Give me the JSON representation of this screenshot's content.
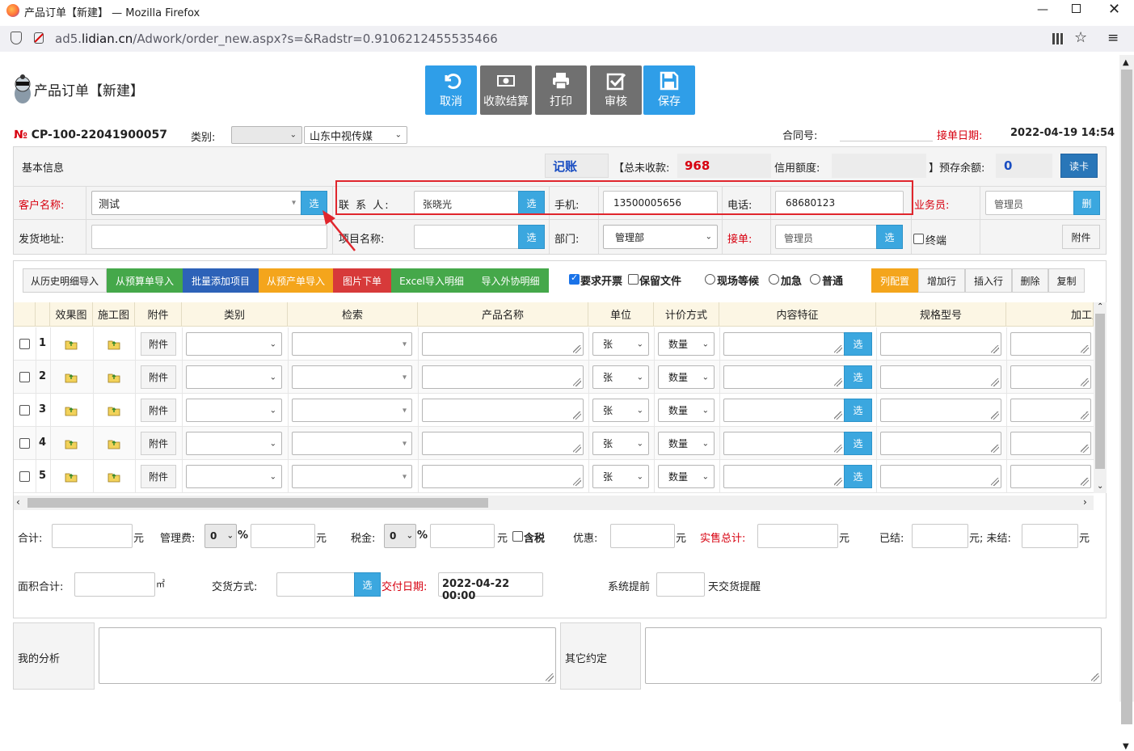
{
  "window": {
    "title": "产品订单【新建】 — Mozilla Firefox"
  },
  "browser": {
    "url_domain": "ad5.",
    "url_domain_bold": "lidian.cn",
    "url_path": "/Adwork/order_new.aspx?s=&Radstr=0.9106212455535466"
  },
  "page": {
    "title": "产品订单【新建】"
  },
  "toolbar": {
    "cancel": "取消",
    "payment": "收款结算",
    "print": "打印",
    "audit": "审核",
    "save": "保存"
  },
  "order": {
    "no_prefix": "№",
    "no": "CP-100-22041900057",
    "category_label": "类别:",
    "category_value": "",
    "company_value": "山东中视传媒",
    "contract_label": "合同号:",
    "receive_date_label": "接单日期:",
    "receive_date": "2022-04-19 14:54"
  },
  "basic": {
    "section_title": "基本信息",
    "bookkeeping": "记账",
    "total_unpaid_label": "【总未收款:",
    "total_unpaid": "968",
    "credit_label": "信用额度:",
    "prepaid_label": "】预存余额:",
    "prepaid": "0",
    "read_card": "读卡",
    "customer_label": "客户名称:",
    "customer_value": "测试",
    "select": "选",
    "contact_label": "联 系 人:",
    "contact_value": "张晓光",
    "mobile_label": "手机:",
    "mobile_value": "13500005656",
    "phone_label": "电话:",
    "phone_value": "68680123",
    "salesman_label": "业务员:",
    "salesman_value": "管理员",
    "delete": "删",
    "address_label": "发货地址:",
    "project_label": "项目名称:",
    "dept_label": "部门:",
    "dept_value": "管理部",
    "taker_label": "接单:",
    "taker_value": "管理员",
    "terminal_label": "终端",
    "attachment": "附件"
  },
  "tools": {
    "history": "从历史明细导入",
    "budget": "从预算单导入",
    "batch": "批量添加项目",
    "preproduce": "从预产单导入",
    "image_order": "图片下单",
    "excel": "Excel导入明细",
    "outsource": "导入外协明细",
    "invoice": "要求开票",
    "keep_file": "保留文件",
    "onsite": "现场等候",
    "urgent": "加急",
    "normal": "普通",
    "col_config": "列配置",
    "add_row": "增加行",
    "insert_row": "插入行",
    "delete": "删除",
    "copy": "复制"
  },
  "table": {
    "headers": [
      "效果图",
      "施工图",
      "附件",
      "类别",
      "检索",
      "产品名称",
      "单位",
      "计价方式",
      "内容特征",
      "规格型号",
      "加工厂"
    ],
    "rows": [
      {
        "no": "1",
        "attach": "附件",
        "unit": "张",
        "pricing": "数量",
        "select": "选"
      },
      {
        "no": "2",
        "attach": "附件",
        "unit": "张",
        "pricing": "数量",
        "select": "选"
      },
      {
        "no": "3",
        "attach": "附件",
        "unit": "张",
        "pricing": "数量",
        "select": "选"
      },
      {
        "no": "4",
        "attach": "附件",
        "unit": "张",
        "pricing": "数量",
        "select": "选"
      },
      {
        "no": "5",
        "attach": "附件",
        "unit": "张",
        "pricing": "数量",
        "select": "选"
      }
    ]
  },
  "totals": {
    "sum_label": "合计:",
    "yuan": "元",
    "mgmt_label": "管理费:",
    "mgmt_pct": "0",
    "pct": "%",
    "tax_label": "税金:",
    "tax_pct": "0",
    "incl_tax": "含税",
    "discount_label": "优惠:",
    "sales_total_label": "实售总计:",
    "settled_label": "已结:",
    "unsettled_label": "元; 未结:",
    "area_label": "面积合计:",
    "sqm": "㎡",
    "delivery_label": "交货方式:",
    "select": "选",
    "delivery_date_label": "交付日期:",
    "delivery_date": "2022-04-22 00:00",
    "advance_label": "系统提前",
    "advance_suffix": "天交货提醒"
  },
  "notes": {
    "analysis_label": "我的分析",
    "other_label": "其它约定"
  }
}
